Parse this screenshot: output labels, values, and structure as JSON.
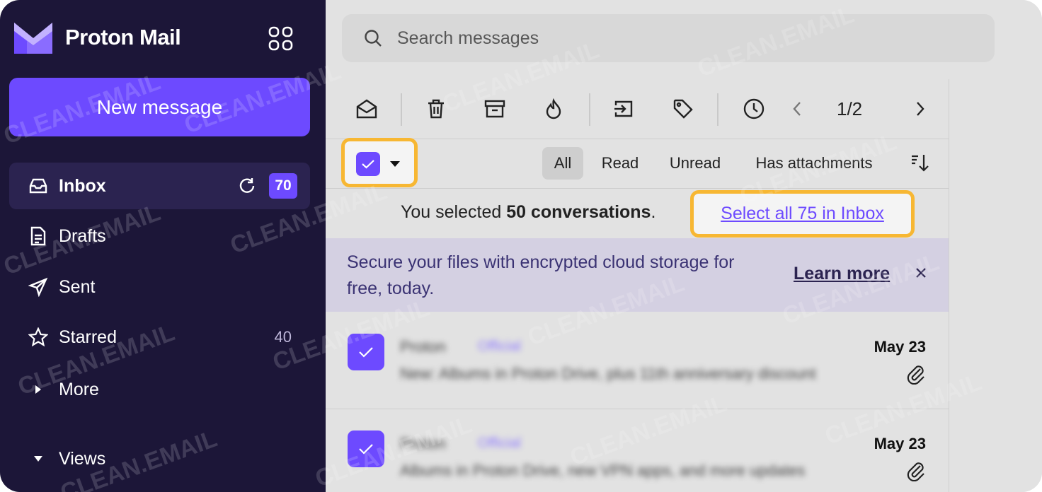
{
  "brand": {
    "name": "Proton Mail"
  },
  "sidebar": {
    "new_message_label": "New message",
    "items": [
      {
        "label": "Inbox",
        "badge": "70"
      },
      {
        "label": "Drafts"
      },
      {
        "label": "Sent"
      },
      {
        "label": "Starred",
        "count": "40"
      },
      {
        "label": "More"
      },
      {
        "label": "Views"
      }
    ]
  },
  "search": {
    "placeholder": "Search messages"
  },
  "toolbar": {
    "pager": "1/2"
  },
  "filters": {
    "all": "All",
    "read": "Read",
    "unread": "Unread",
    "attachments": "Has attachments"
  },
  "selection": {
    "prefix": "You selected ",
    "count": "50 conversations",
    "suffix": ".",
    "select_all": "Select all 75 in Inbox"
  },
  "promo": {
    "text": "Secure your files with encrypted cloud storage for free, today.",
    "link": "Learn more"
  },
  "messages": [
    {
      "sender": "Proton",
      "tag": "Official",
      "subject": "New: Albums in Proton Drive, plus 11th anniversary discount",
      "date": "May 23"
    },
    {
      "sender": "Proton",
      "tag": "Official",
      "subject": "Albums in Proton Drive, new VPN apps, and more updates",
      "date": "May 23"
    }
  ],
  "watermark": "CLEAN.EMAIL",
  "colors": {
    "accent": "#6d4aff",
    "sidebar": "#1c1638",
    "highlight": "#f7b733"
  }
}
